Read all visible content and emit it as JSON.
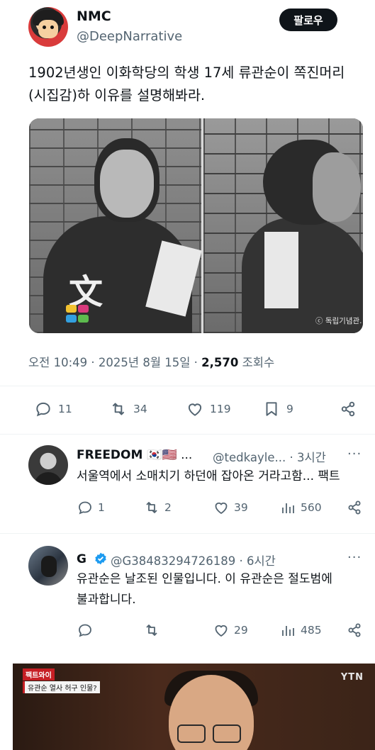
{
  "tweet": {
    "display_name": "NMC",
    "handle": "@DeepNarrative",
    "follow_label": "팔로우",
    "text": "1902년생인 이화학당의 학생 17세 류관순이 쪽진머리(시집감)하 이유를 설명해봐라.",
    "photo": {
      "watermark": "ⓒ 독립기념관.",
      "logo_text": "文"
    },
    "time": "오전 10:49",
    "date": "2025년 8월 15일",
    "views": "2,570",
    "views_label": "조회수",
    "actions": {
      "replies": "11",
      "retweets": "34",
      "likes": "119",
      "bookmarks": "9"
    }
  },
  "replies": [
    {
      "name": "FREEDOM",
      "flags": "🇰🇷🇺🇸 ...",
      "handle": "@tedkayle...",
      "time": "· 3시간",
      "text": "서울역에서 소매치기 하던애 잡아온 거라고함... 팩트",
      "actions": {
        "replies": "1",
        "retweets": "2",
        "likes": "39",
        "views": "560"
      }
    },
    {
      "name": "G",
      "handle": "@G38483294726189",
      "time": "· 6시간",
      "text_line1": "유관순은 날조된 인물입니다. 이 유관순은 절도범에",
      "text_line2": "불과합니다.",
      "actions": {
        "replies": "",
        "retweets": "",
        "likes": "29",
        "views": "485"
      }
    }
  ],
  "video": {
    "tag_red": "팩트와이",
    "tag_caption": "유관순 열사 허구 인물?",
    "channel": "YTN"
  },
  "colors": {
    "text": "#0f1419",
    "secondary": "#536471",
    "verified_blue": "#1d9bf0",
    "follow_bg": "#0f1419"
  }
}
